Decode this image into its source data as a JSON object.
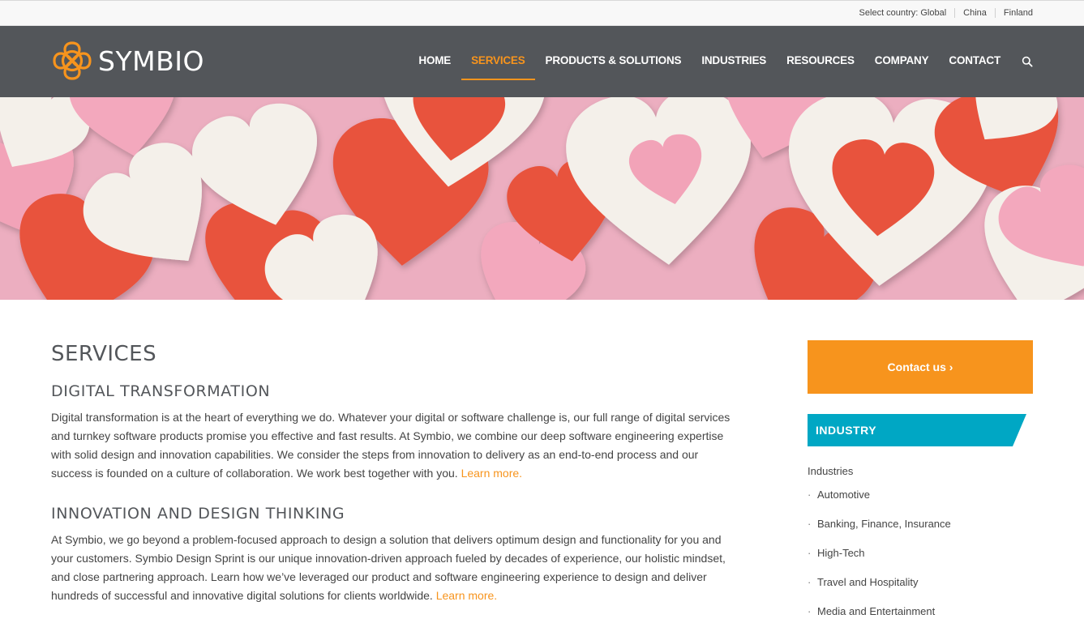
{
  "topbar": {
    "select_country": "Select country: Global",
    "countries": [
      "China",
      "Finland"
    ]
  },
  "brand": {
    "name": "SYMBIO",
    "accent_color": "#f7941d",
    "header_color": "#53565a",
    "industry_color": "#00a7c4"
  },
  "nav": {
    "items": [
      "HOME",
      "SERVICES",
      "PRODUCTS & SOLUTIONS",
      "INDUSTRIES",
      "RESOURCES",
      "COMPANY",
      "CONTACT"
    ],
    "active": "SERVICES",
    "search_icon": "search-icon"
  },
  "hero": {
    "icon": "hearts-photo"
  },
  "main": {
    "title": "SERVICES",
    "sections": [
      {
        "heading": "DIGITAL TRANSFORMATION",
        "body": "Digital transformation is at the heart of everything we do. Whatever your digital or software challenge is, our full range of digital services and turnkey software products promise you effective and fast results. At Symbio, we combine our deep software engineering expertise with solid design and innovation capabilities. We consider the steps from innovation to delivery as an end-to-end process and our success is founded on a culture of collaboration. We work best together with you.",
        "link": "Learn more."
      },
      {
        "heading": "INNOVATION AND DESIGN THINKING",
        "body": "At Symbio, we go beyond a problem-focused approach to design a solution that delivers optimum design and functionality for you and your customers. Symbio Design Sprint is our unique innovation-driven approach fueled by decades of experience, our holistic mindset, and close partnering approach. Learn how we’ve leveraged our product and software engineering experience to design and deliver hundreds of successful and innovative digital solutions for clients worldwide.",
        "link": "Learn more."
      }
    ]
  },
  "sidebar": {
    "contact_label": "Contact us ›",
    "industry_label": "INDUSTRY",
    "list_title": "Industries",
    "items": [
      "Automotive",
      "Banking, Finance, Insurance",
      "High-Tech",
      "Travel and Hospitality",
      "Media and Entertainment"
    ]
  }
}
